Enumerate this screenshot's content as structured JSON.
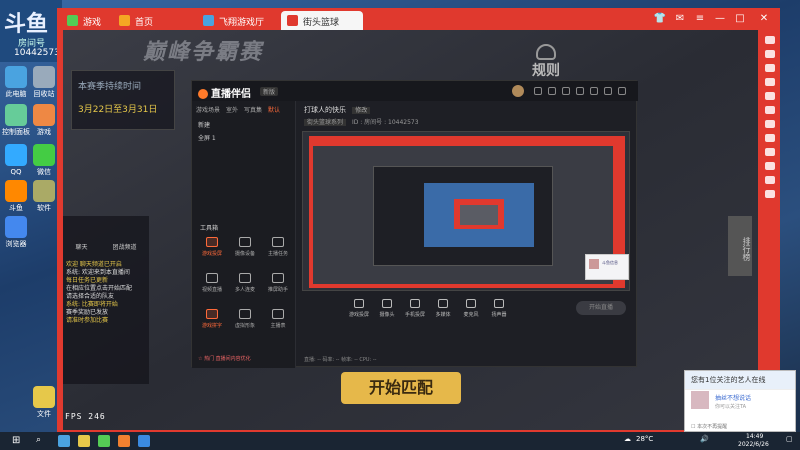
{
  "desktop": {
    "badge": {
      "logo": "斗鱼",
      "label": "房间号",
      "room": "10442573"
    },
    "icons": [
      {
        "label": "此电脑",
        "color": "#4aa3e0"
      },
      {
        "label": "回收站",
        "color": "#9ab"
      },
      {
        "label": "控制面板",
        "color": "#6c9"
      },
      {
        "label": "游戏",
        "color": "#e84"
      },
      {
        "label": "QQ",
        "color": "#3af"
      },
      {
        "label": "微信",
        "color": "#4c4"
      },
      {
        "label": "斗鱼",
        "color": "#f80"
      },
      {
        "label": "软件",
        "color": "#aa6"
      },
      {
        "label": "浏览器",
        "color": "#48e"
      },
      {
        "label": "文件",
        "color": "#e6c84a"
      }
    ]
  },
  "browser": {
    "tabs": [
      {
        "label": "首页",
        "color": "#f5a623"
      },
      {
        "label": "飞翔游戏厅",
        "color": "#4aa3e0"
      },
      {
        "label": "街头篮球",
        "color": "#e0392e"
      }
    ],
    "logo_text": "游戏中心"
  },
  "game": {
    "banner": "巅峰争霸赛",
    "rules_label": "规则",
    "season_title": "本赛季持续时间",
    "season_dates": "3月22日至3月31日",
    "start_button": "开始匹配",
    "ranking": "排行榜",
    "fps": "FPS 246",
    "chat": {
      "tabs": [
        "聊天",
        "团战频道"
      ],
      "lines": [
        {
          "text": "欢迎 聊天频道已开启",
          "white": false
        },
        {
          "text": "系统: 欢迎来到本直播间",
          "white": true
        },
        {
          "text": "每日任务已更新",
          "white": false
        },
        {
          "text": "在相应位置点击开始匹配",
          "white": true
        },
        {
          "text": "请选择合适的队友",
          "white": true
        },
        {
          "text": "系统: 比赛即将开始",
          "white": false
        },
        {
          "text": "赛季奖励已发放",
          "white": true
        },
        {
          "text": "请准时参加比赛",
          "white": false
        }
      ]
    }
  },
  "obs": {
    "title": "直播伴侣",
    "version": "新版",
    "scene_tabs": [
      "游戏场景",
      "室外",
      "写真集",
      "默认"
    ],
    "scene_active": 3,
    "scene_items": [
      "新建",
      "全屏 1"
    ],
    "tools_title": "工具箱",
    "tools": [
      {
        "label": "游戏投屏",
        "hot": true
      },
      {
        "label": "摄像设备",
        "hot": false
      },
      {
        "label": "主播任务",
        "hot": false
      },
      {
        "label": "视频直播",
        "hot": false
      },
      {
        "label": "多人连麦",
        "hot": false
      },
      {
        "label": "推屏助手",
        "hot": false
      },
      {
        "label": "游戏拼字",
        "hot": true
      },
      {
        "label": "虚拟形象",
        "hot": false
      },
      {
        "label": "主播表",
        "hot": false
      }
    ],
    "stream_title": "打球人的快乐",
    "stream_tag": "修改",
    "info_tag": "街头篮球系列",
    "info_text": "ID : 房间号 : 10442573",
    "controls": [
      "游戏投屏",
      "摄像头",
      "手机投屏",
      "多媒体",
      "麦克风",
      "扬声器"
    ],
    "go_live": "开始直播",
    "bottom_hint": "☆ 热门 直播间内容优化",
    "status": "直播: --   码率: --   帧率: --   CPU: --",
    "mini_popup": "斗鱼信息"
  },
  "notification": {
    "header": "您有1位关注的艺人在线",
    "name": "抽丝不想说话",
    "sub": "你可以关注TA",
    "check": "本次不再提醒"
  },
  "taskbar": {
    "temperature": "28°C",
    "time": "14:49",
    "date": "2022/6/26"
  }
}
